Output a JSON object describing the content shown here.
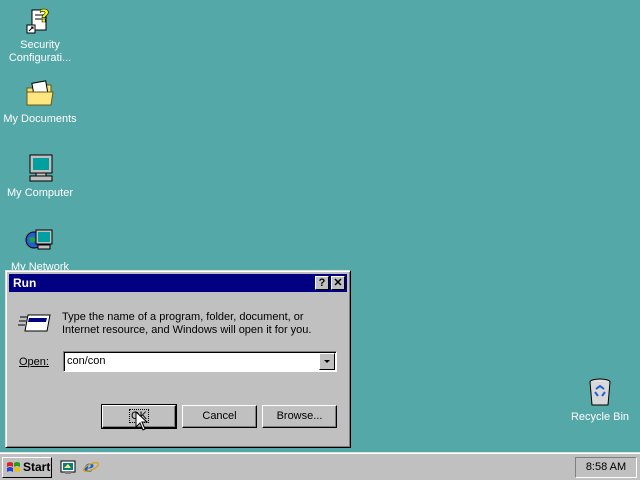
{
  "desktop": {
    "background_color": "#55a8a8",
    "icons": [
      {
        "label": "Security Configurati...",
        "icon": "security-config-icon"
      },
      {
        "label": "My Documents",
        "icon": "folder-icon"
      },
      {
        "label": "My Computer",
        "icon": "computer-icon"
      },
      {
        "label": "My Network",
        "icon": "network-icon"
      },
      {
        "label": "Recycle Bin",
        "icon": "recycle-bin-icon"
      }
    ]
  },
  "run_dialog": {
    "title": "Run",
    "help_button": "?",
    "close_button": "✕",
    "description_line1": "Type the name of a program, folder, document, or",
    "description_line2": "Internet resource, and Windows will open it for you.",
    "open_label": "Open:",
    "open_value": "con/con",
    "ok_label": "OK",
    "cancel_label": "Cancel",
    "browse_label": "Browse..."
  },
  "taskbar": {
    "start_label": "Start",
    "quick_launch": [
      "desktop-icon",
      "internet-explorer-icon"
    ],
    "clock": "8:58 AM"
  },
  "colors": {
    "titlebar": "#000080",
    "face": "#c0c0c0"
  }
}
